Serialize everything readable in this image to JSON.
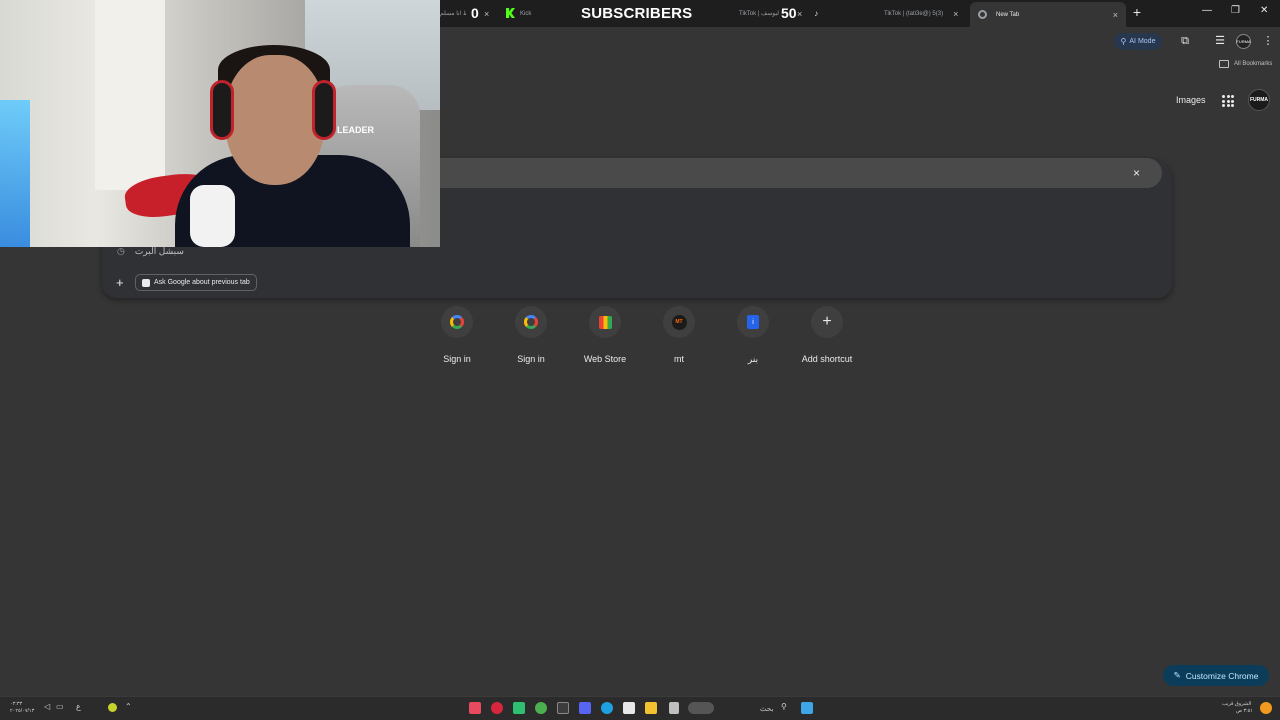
{
  "browser": {
    "tabs": [
      {
        "title": "ليش تغلط انا مسلم",
        "active": false
      },
      {
        "title": "Kick",
        "active": false
      },
      {
        "title": "TikTok | بيع اليوسف",
        "active": false
      },
      {
        "title": "TikTok | (tati3e@) 5(3)",
        "active": false
      },
      {
        "title": "New Tab",
        "active": true
      }
    ],
    "new_tab_label": "+",
    "close_glyph": "×",
    "window_controls": {
      "minimize": "—",
      "restore": "❐",
      "close": "✕"
    },
    "ai_mode_label": "AI Mode",
    "all_bookmarks_label": "All Bookmarks",
    "profile_initials": "FURMA"
  },
  "overlay": {
    "left_count": "0",
    "subscribers_label": "SUBSCRIBERS",
    "right_count": "50"
  },
  "webcam": {
    "chair_brand": "LEADER"
  },
  "google": {
    "images_label": "Images",
    "avatar_text": "FURMA",
    "search": {
      "clear_glyph": "×",
      "history_suggestion": "سبشل البرت",
      "ask_chip_label": "Ask Google about previous tab",
      "add_glyph": "+"
    },
    "shortcuts": [
      {
        "label": "Sign in",
        "icon": "google-icon"
      },
      {
        "label": "Sign in",
        "icon": "google-icon"
      },
      {
        "label": "Web Store",
        "icon": "web-store-icon"
      },
      {
        "label": "mt",
        "icon": "mt-icon"
      },
      {
        "label": "بنر",
        "icon": "banner-icon"
      },
      {
        "label": "Add shortcut",
        "icon": "plus-icon"
      }
    ],
    "mt_logo_text": "MT",
    "customize_label": "Customize Chrome"
  },
  "taskbar": {
    "clock_time": "٠٣:٣٣",
    "clock_date": "٢٠٢٥/٠٧/١٣",
    "search_placeholder": "بحث",
    "weather_label": "الشروق قريب",
    "weather_sub": "٣:٥١ ص"
  },
  "colors": {
    "page_bg": "#353535",
    "tabstrip_bg": "#1e1e1e",
    "customize_bg": "#0b3d5b",
    "kick_green": "#53fc18"
  }
}
